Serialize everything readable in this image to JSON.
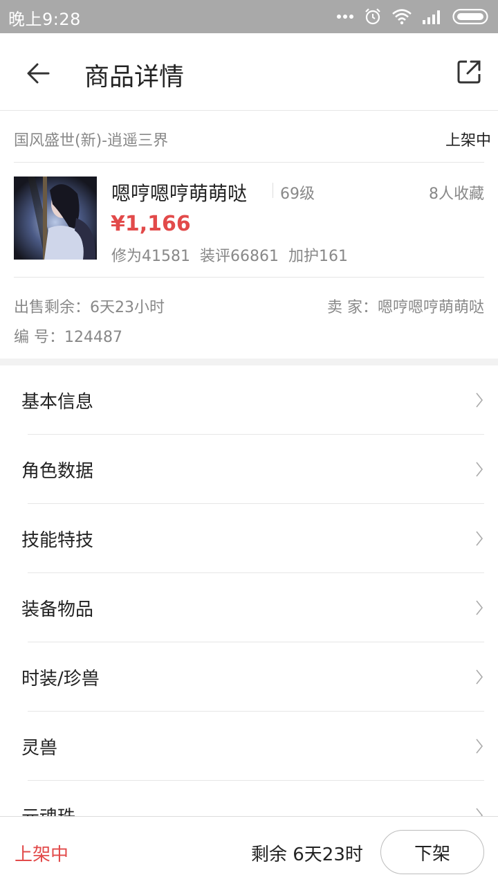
{
  "status_bar": {
    "time": "晚上9:28",
    "icons": [
      "more-dots-icon",
      "alarm-icon",
      "wifi-icon",
      "signal-icon",
      "battery-icon"
    ]
  },
  "header": {
    "title": "商品详情",
    "back_icon": "back-arrow-icon",
    "share_icon": "share-external-icon"
  },
  "product": {
    "server": "国风盛世(新)-逍遥三界",
    "listing_status": "上架中",
    "name": "嗯哼嗯哼萌萌哒",
    "level": "69级",
    "favorites": "8人收藏",
    "price": "¥1,166",
    "stats": [
      "修为41581",
      "装评66861",
      "加护161"
    ],
    "remaining": "出售剩余：6天23小时",
    "seller": "卖  家：嗯哼嗯哼萌萌哒",
    "number": "编  号：124487"
  },
  "menu": {
    "items": [
      {
        "label": "基本信息"
      },
      {
        "label": "角色数据"
      },
      {
        "label": "技能特技"
      },
      {
        "label": "装备物品"
      },
      {
        "label": "时装/珍兽"
      },
      {
        "label": "灵兽"
      },
      {
        "label": "元魂珠"
      }
    ]
  },
  "footer": {
    "status": "上架中",
    "remaining": "剩余 6天23时",
    "delist_button": "下架"
  },
  "colors": {
    "status_bar_bg": "#a9a9a9",
    "price_red": "#e24a4a",
    "secondary_text": "#888888",
    "divider": "#e6e6e6"
  }
}
